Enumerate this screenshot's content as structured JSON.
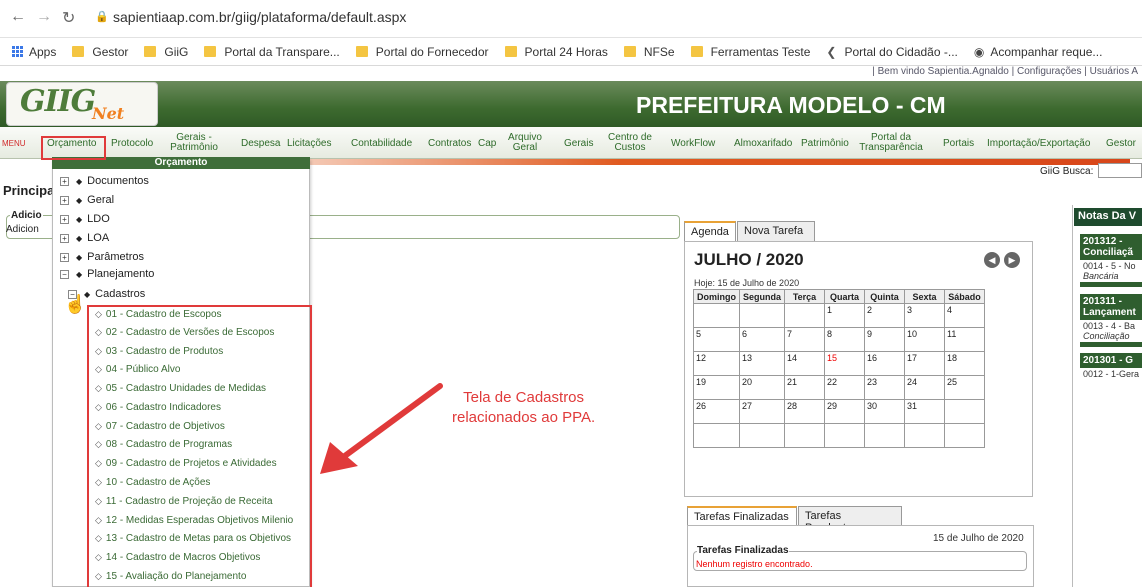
{
  "browser": {
    "url": "sapientiaap.com.br/giig/plataforma/default.aspx"
  },
  "bookmarks": [
    "Apps",
    "Gestor",
    "GiiG",
    "Portal da Transpare...",
    "Portal do Fornecedor",
    "Portal 24 Horas",
    "NFSe",
    "Ferramentas Teste",
    "Portal do Cidadão -...",
    "Acompanhar reque..."
  ],
  "header": {
    "welcome": "|  Bem vindo Sapientia.Agnaldo   |  Configurações   |  Usuários A",
    "logo": "GIIG",
    "logo_sub": "Net",
    "title": "PREFEITURA MODELO - CM"
  },
  "menu": {
    "label": "MENU",
    "items": [
      "Orçamento",
      "Protocolo",
      "Gerais - Patrimônio",
      "Despesa",
      "Licitações",
      "Contabilidade",
      "Contratos",
      "Cap",
      "Arquivo Geral",
      "Gerais",
      "Centro de Custos",
      "WorkFlow",
      "Almoxarifado",
      "Patrimônio",
      "Portal da Transparência",
      "Portais",
      "Importação/Exportação",
      "Gestor"
    ]
  },
  "busca_label": "GiiG Busca:",
  "principal": "Principal",
  "adicionar": {
    "legend": "Adicio",
    "text": "Adicion"
  },
  "dropdown": {
    "header": "Orçamento",
    "tree": [
      "Documentos",
      "Geral",
      "LDO",
      "LOA",
      "Parâmetros",
      "Planejamento",
      "Cadastros"
    ],
    "cadastros": [
      "01 - Cadastro de Escopos",
      "02 - Cadastro de Versões de Escopos",
      "03 - Cadastro de Produtos",
      "04 - Público Alvo",
      "05 - Cadastro Unidades de Medidas",
      "06 - Cadastro Indicadores",
      "07 - Cadastro de Objetivos",
      "08 - Cadastro de Programas",
      "09 - Cadastro de Projetos e Atividades",
      "10 - Cadastro de Ações",
      "11 - Cadastro de Projeção de Receita",
      "12 - Medidas Esperadas Objetivos Milenio",
      "13 - Cadastro de Metas para os Objetivos",
      "14 - Cadastro de Macros Objetivos",
      "15 - Avaliação do Planejamento"
    ]
  },
  "annotation": {
    "line1": "Tela de Cadastros",
    "line2": "relacionados ao PPA."
  },
  "agenda": {
    "tabs": [
      "Agenda",
      "Nova Tarefa"
    ],
    "month": "JULHO  /  2020",
    "hoje": "Hoje:  15 de Julho de 2020",
    "days": [
      "Domingo",
      "Segunda",
      "Terça",
      "Quarta",
      "Quinta",
      "Sexta",
      "Sábado"
    ],
    "weeks": [
      [
        "",
        "",
        "",
        "1",
        "2",
        "3",
        "4"
      ],
      [
        "5",
        "6",
        "7",
        "8",
        "9",
        "10",
        "11"
      ],
      [
        "12",
        "13",
        "14",
        "15",
        "16",
        "17",
        "18"
      ],
      [
        "19",
        "20",
        "21",
        "22",
        "23",
        "24",
        "25"
      ],
      [
        "26",
        "27",
        "28",
        "29",
        "30",
        "31",
        ""
      ],
      [
        "",
        "",
        "",
        "",
        "",
        "",
        ""
      ]
    ],
    "today": "15"
  },
  "tarefas": {
    "tabs": [
      "Tarefas Finalizadas",
      "Tarefas Pendentes"
    ],
    "date": "15 de Julho de 2020",
    "legend": "Tarefas Finalizadas",
    "empty": "Nenhum registro encontrado."
  },
  "notas": {
    "title": "Notas Da V",
    "items": [
      {
        "code": "201312    -",
        "subtitle": "Conciliaçã",
        "line1": "0014 - 5 - No",
        "line2": "Bancária"
      },
      {
        "code": "201311    -",
        "subtitle": "Lançament",
        "line1": "0013 - 4 - Ba",
        "line2": "Conciliação"
      },
      {
        "code": "201301 - G",
        "subtitle": "",
        "line1": "0012 - 1-Gera",
        "line2": ""
      }
    ]
  }
}
